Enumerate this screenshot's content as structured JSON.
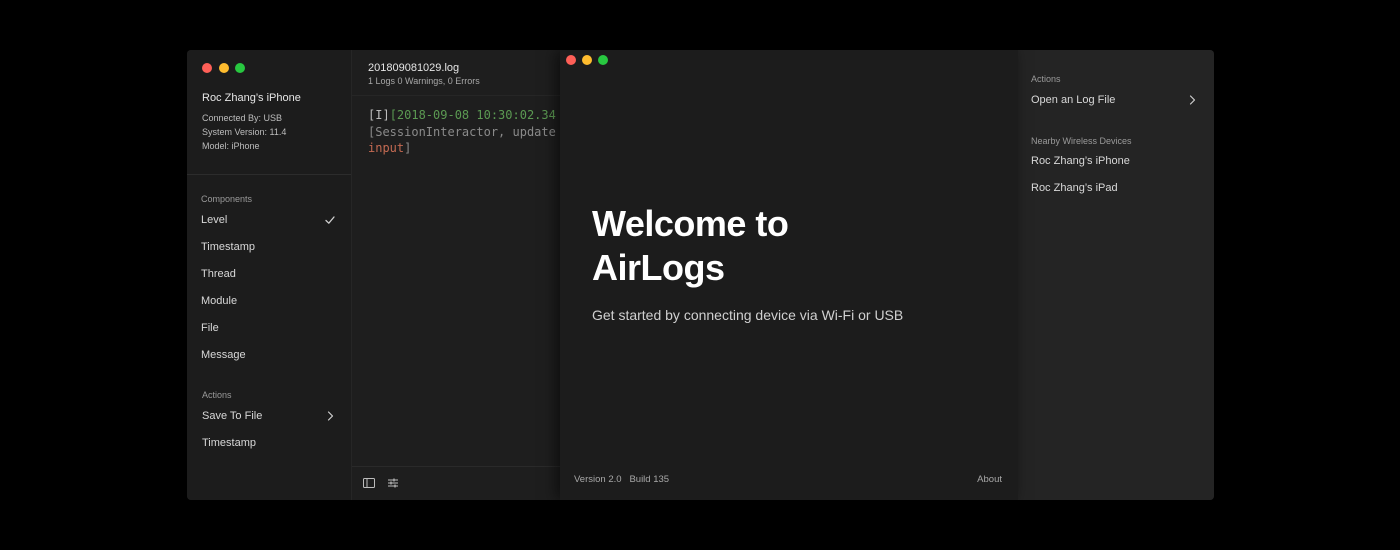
{
  "device_window": {
    "sidebar": {
      "device": {
        "name": "Roc Zhang’s iPhone",
        "connected_by": "Connected By: USB",
        "system_version": "System Version: 11.4",
        "model": "Model: iPhone"
      },
      "components_header": "Components",
      "components": [
        {
          "label": "Level",
          "checked": true
        },
        {
          "label": "Timestamp",
          "checked": false
        },
        {
          "label": "Thread",
          "checked": false
        },
        {
          "label": "Module",
          "checked": false
        },
        {
          "label": "File",
          "checked": false
        },
        {
          "label": "Message",
          "checked": false
        }
      ],
      "actions_header": "Actions",
      "actions": [
        {
          "label": "Save To File",
          "has_submenu": true
        },
        {
          "label": "Timestamp",
          "has_submenu": false
        }
      ]
    },
    "log_pane": {
      "filename": "201809081029.log",
      "summary": "1 Logs  0 Warnings, 0 Errors",
      "entry": {
        "level": "[I]",
        "timestamp_fragment": "[2018-09-08 10:30:02.34",
        "source_fragment": "[SessionInteractor, update",
        "message_fragment": "input",
        "closing": "]"
      },
      "footer_icons": [
        "sidebar-toggle-icon",
        "filter-sliders-icon"
      ]
    },
    "right_panel": {
      "actions_header": "Actions",
      "actions": [
        {
          "label": "Open an Log File",
          "has_submenu": true
        }
      ],
      "nearby_header": "Nearby Wireless Devices",
      "nearby_devices": [
        {
          "label": "Roc Zhang’s iPhone"
        },
        {
          "label": "Roc Zhang’s iPad"
        }
      ]
    }
  },
  "welcome_window": {
    "title": "Welcome to AirLogs",
    "subtitle": "Get started by connecting device via Wi-Fi or USB",
    "version": "Version 2.0   Build 135",
    "about": "About"
  },
  "colors": {
    "background": "#000000",
    "window_bg": "#1e1e1e",
    "traffic_red": "#fe5f57",
    "traffic_yellow": "#febc2e",
    "traffic_green": "#28c840",
    "log_timestamp": "#5b9a52",
    "log_message": "#c46a52"
  }
}
